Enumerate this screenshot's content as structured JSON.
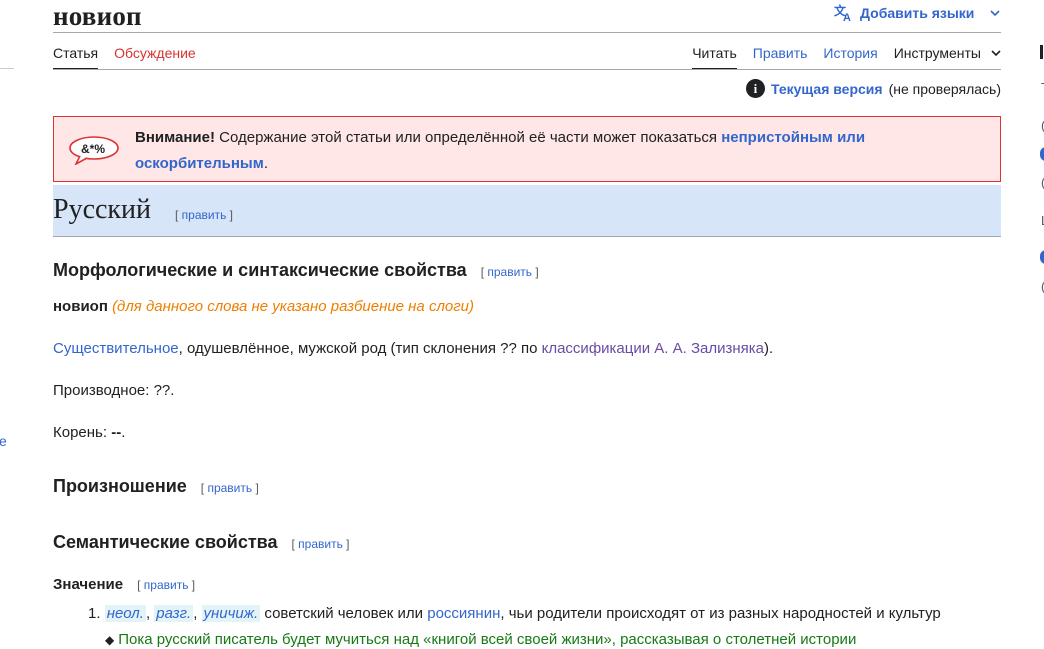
{
  "page": {
    "title": "новиоп",
    "add_languages": "Добавить языки",
    "edit_word": "править"
  },
  "tabs": {
    "article": "Статья",
    "discussion": "Обсуждение",
    "read": "Читать",
    "edit": "Править",
    "history": "История",
    "tools": "Инструменты"
  },
  "version": {
    "current": "Текущая версия",
    "status": "(не проверялась)"
  },
  "warning": {
    "icon_text": "&*%",
    "lead": "Внимание!",
    "text": " Содержание этой статьи или определённой её части может показаться ",
    "link": "непристойным или оскорбительным",
    "tail": "."
  },
  "sections": {
    "language": "Русский",
    "morph": "Морфологические и синтаксические свойства",
    "pron": "Произношение",
    "sem": "Семантические свойства",
    "meaning": "Значение"
  },
  "morph": {
    "word": "новиоп",
    "syllable_note": "(для данного слова не указано разбиение на слоги)",
    "pos_link": "Существительное",
    "pos_text": ", одушевлённое, мужской род (тип склонения ?? по ",
    "class_link": "классификации А. А. Зализняка",
    "pos_end": ").",
    "derivative": "Производное: ??.",
    "root_label": "Корень: ",
    "root_value": "--",
    "root_end": "."
  },
  "definition": {
    "number": "1.",
    "mark1": "неол.",
    "mark2": "разг.",
    "mark3": "уничиж.",
    "text1": " советский человек или ",
    "link": "россиянин",
    "text2": ", чьи родители происходят от из разных народностей и культур",
    "example": "Пока русский писатель будет мучиться над «книгой всей своей жизни», рассказывая о столетней истории"
  },
  "fragments": {
    "left": "e",
    "right_paren": "(",
    "right_l": "L",
    "right_t": "T",
    "right_i": "I"
  }
}
